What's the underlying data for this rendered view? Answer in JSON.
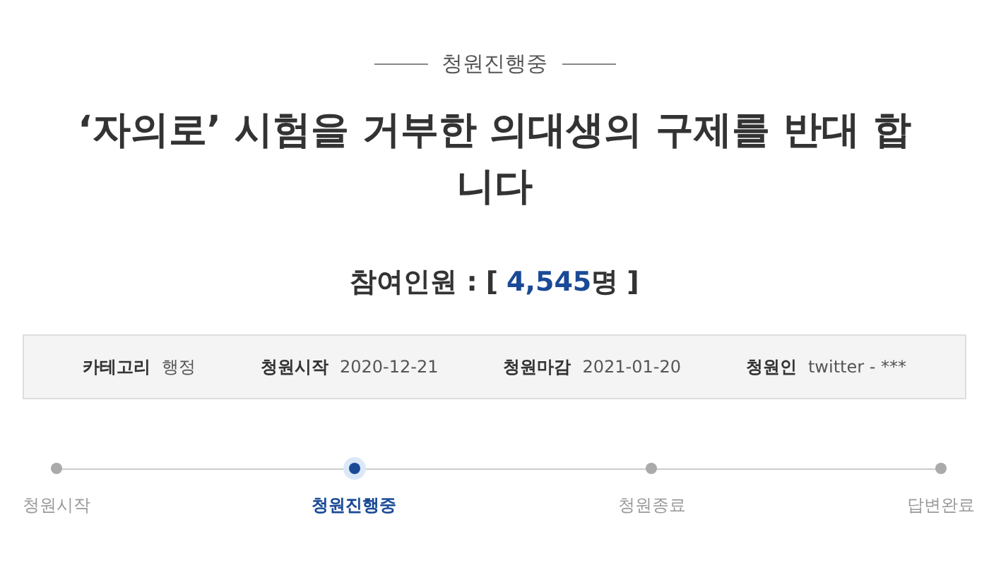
{
  "status_label": "청원진행중",
  "title": "‘자의로’ 시험을 거부한 의대생의 구제를 반대 합니다",
  "participants": {
    "label": "참여인원 :",
    "open": "[",
    "count": "4,545",
    "unit": "명",
    "close": "]"
  },
  "info": [
    {
      "label": "카테고리",
      "value": "행정"
    },
    {
      "label": "청원시작",
      "value": "2020-12-21"
    },
    {
      "label": "청원마감",
      "value": "2021-01-20"
    },
    {
      "label": "청원인",
      "value": "twitter - ***"
    }
  ],
  "steps": [
    {
      "label": "청원시작",
      "selected": false
    },
    {
      "label": "청원진행중",
      "selected": true
    },
    {
      "label": "청원종료",
      "selected": false
    },
    {
      "label": "답변완료",
      "selected": false
    }
  ]
}
